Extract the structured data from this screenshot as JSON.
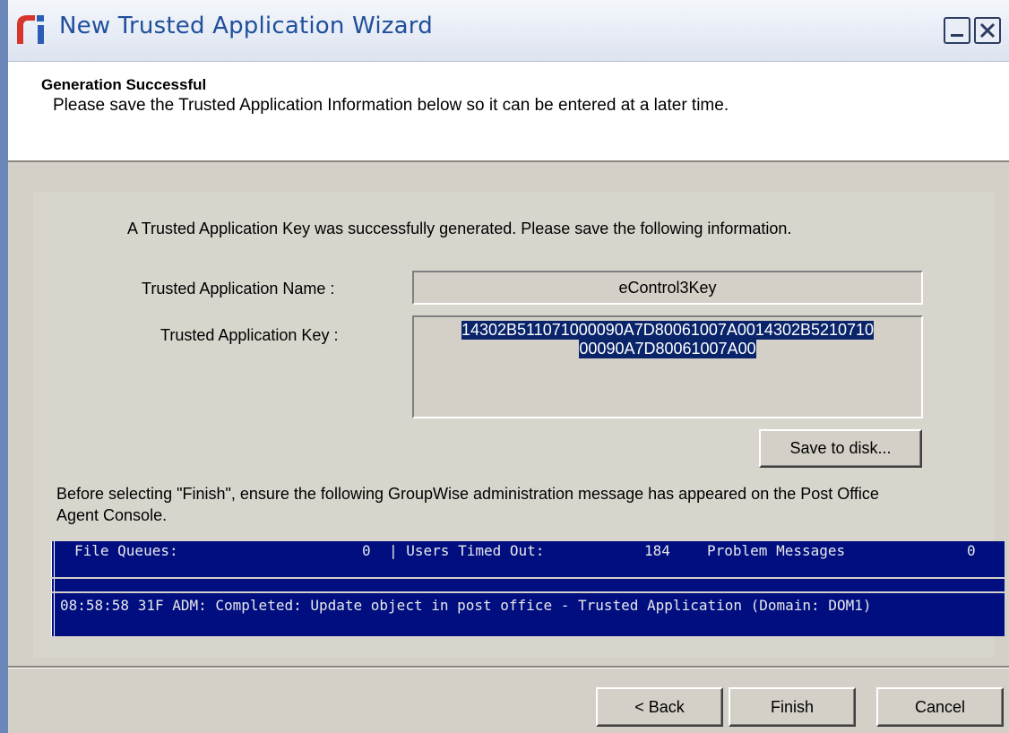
{
  "window": {
    "title": "New Trusted Application Wizard",
    "logo_icon": "novell-logo-icon",
    "minimize_icon": "minimize-icon",
    "close_icon": "close-icon"
  },
  "header": {
    "title": "Generation Successful",
    "description": "Please save the Trusted Application Information below so it can be entered at a later time."
  },
  "content": {
    "intro": "A Trusted Application Key was successfully generated.  Please save the following information.",
    "name_label": "Trusted Application Name :",
    "name_value": "eControl3Key",
    "key_label": "Trusted Application Key :",
    "key_value_line1": "14302B511071000090A7D80061007A0014302B5210710",
    "key_value_line2": "00090A7D80061007A00",
    "save_button": "Save to disk...",
    "note": "Before selecting \"Finish\", ensure the following GroupWise administration message has appeared on the Post Office Agent Console."
  },
  "console": {
    "file_queues_label": "File Queues:",
    "file_queues_value": "0",
    "users_timed_out_label": "| Users Timed Out:",
    "users_timed_out_value": "184",
    "problem_messages_label": "Problem Messages",
    "problem_messages_value": "0",
    "log_message": "08:58:58 31F ADM: Completed: Update object in post office -  Trusted Application  (Domain: DOM1)"
  },
  "footer": {
    "back_button": "< Back",
    "finish_button": "Finish",
    "cancel_button": "Cancel"
  },
  "colors": {
    "title_text": "#1f4f9c",
    "selection": "#0a246a",
    "console_bg": "#000e80"
  }
}
